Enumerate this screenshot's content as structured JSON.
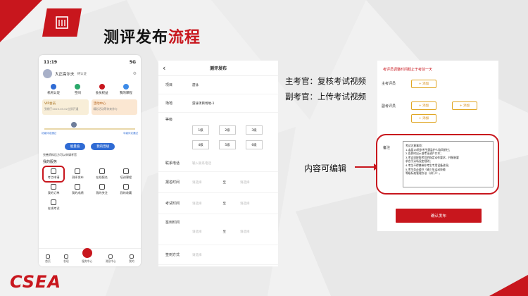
{
  "slide": {
    "title_part1": "测评发布",
    "title_part2": "流程",
    "brand": "CSEA",
    "colors": {
      "accent": "#c8161d",
      "blue": "#2f6bd4",
      "gold": "#e0a623"
    }
  },
  "phone1": {
    "time": "11:19",
    "signal": "5G",
    "username": "大正高尔夫",
    "badge": "待认证",
    "quick": [
      "机构认证",
      "空间",
      "会员权益",
      "我的课程"
    ],
    "vip": {
      "title": "VIP会员",
      "sub": "到期于2025.03.02立即开通"
    },
    "activity": {
      "title": "活动中心",
      "sub": "精彩活动等你来参与"
    },
    "progress_labels": [
      "初级评定通过",
      "中级评定通过"
    ],
    "btn_left": "能量值",
    "btn_right": "我的晋级",
    "line1": "完善资料后方可以申请考官",
    "section": "我的服务",
    "services": [
      "考点申请",
      "测评发布",
      "在线报名",
      "培训课程",
      "我的订单",
      "我的成绩",
      "我的关注",
      "我的收藏",
      "在线考试"
    ],
    "tabs": [
      "首页",
      "发现",
      "服务中心",
      "消息中心",
      "我的"
    ]
  },
  "phone2": {
    "title": "测评发布",
    "project_label": "项目",
    "project_value": "游泳",
    "venue_label": "场地",
    "venue_value": "游泳项目场地-1",
    "level_label": "等级",
    "levels": [
      "1级",
      "2级",
      "3级",
      "4级",
      "5级",
      "6级"
    ],
    "phone_label": "联系电话",
    "phone_placeholder": "输入联系电话",
    "signup_label": "报名时间",
    "exam_label": "考试时间",
    "checkin_label": "签到时间",
    "checkin_method_label": "签到方式",
    "select_placeholder": "请选择",
    "to": "至"
  },
  "roles": {
    "chief": "主考官：复核考试视频",
    "deputy": "副考官：上传考试视频"
  },
  "annotation": "内容可编辑",
  "phone3": {
    "tip": "考评员调整时间截止于考前一天",
    "chief_label": "主考评员",
    "deputy_label": "副考评员",
    "add": "+ 添加",
    "note_label": "备注",
    "note_lines": [
      "考试注意事项：",
      "1.本届15周岁考生需监护人陪同前往；",
      "2.签到时出示准考证或户口本；",
      "3.考试须按照考官的指定动作要求，并服装要",
      "求合乎泳场设定规则；",
      "4.考生不得携带非考生专用设备进场；",
      "5.考生务必遵守《青少年运动技能",
      "等级标准管理办法（试行）》。"
    ],
    "confirm": "确认发布"
  }
}
